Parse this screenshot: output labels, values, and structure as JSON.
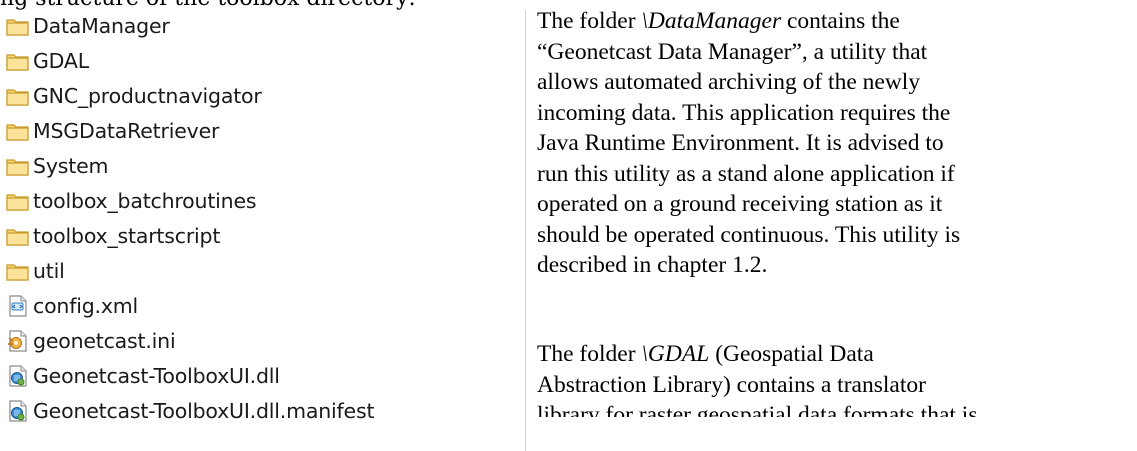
{
  "top_fragment": "ng structure of the toolbox directory:",
  "files": [
    {
      "name": "DataManager",
      "icon": "folder-icon"
    },
    {
      "name": "GDAL",
      "icon": "folder-icon"
    },
    {
      "name": "GNC_productnavigator",
      "icon": "folder-icon"
    },
    {
      "name": "MSGDataRetriever",
      "icon": "folder-icon"
    },
    {
      "name": "System",
      "icon": "folder-icon"
    },
    {
      "name": "toolbox_batchroutines",
      "icon": "folder-icon"
    },
    {
      "name": "toolbox_startscript",
      "icon": "folder-icon"
    },
    {
      "name": "util",
      "icon": "folder-icon"
    },
    {
      "name": "config.xml",
      "icon": "xml-file-icon"
    },
    {
      "name": "geonetcast.ini",
      "icon": "ini-file-icon"
    },
    {
      "name": "Geonetcast-ToolboxUI.dll",
      "icon": "dll-file-icon"
    },
    {
      "name": "Geonetcast-ToolboxUI.dll.manifest",
      "icon": "dll-file-icon"
    }
  ],
  "paragraph1": {
    "l1_pre": "The folder ",
    "l1_italic": "\\DataManager",
    "l1_post": " contains the",
    "l2": "“Geonetcast Data Manager”, a utility that",
    "l3": "allows automated archiving of the newly",
    "l4": "incoming data. This application requires the",
    "l5": "Java Runtime Environment. It is advised to",
    "l6": "run this utility as a stand alone application if",
    "l7": "operated on a ground receiving station as it",
    "l8": "should be operated continuous. This utility is",
    "l9": "described in chapter 1.2."
  },
  "paragraph2": {
    "l1_pre": "The folder ",
    "l1_italic": "\\GDAL",
    "l1_post": " (Geospatial Data",
    "l2": "Abstraction Library) contains a translator",
    "l3": "library for raster geospatial data formats that is"
  }
}
